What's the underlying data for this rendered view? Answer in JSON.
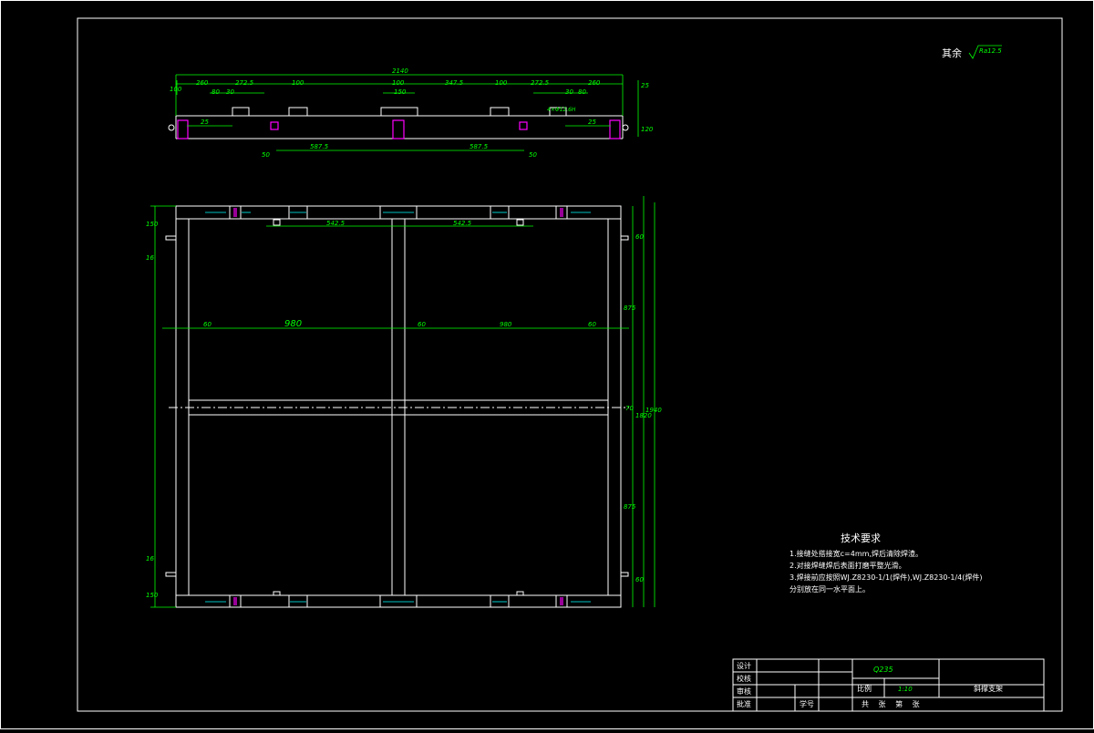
{
  "top_note": {
    "label": "其余",
    "roughness": "Ra12.5"
  },
  "top_view": {
    "dims": {
      "overall": "2140",
      "d260a": "260",
      "d272a": "272.5",
      "d100a": "100",
      "d100b": "100",
      "d347": "347.5",
      "d100c": "100",
      "d272b": "272.5",
      "d260b": "260",
      "d80a": "80",
      "d30a": "30",
      "d150": "150",
      "d30b": "30",
      "d80b": "80",
      "d25a": "25",
      "d25b": "25",
      "d587a": "587.5",
      "d587b": "587.5",
      "d50a": "50",
      "d50b": "50",
      "r25": "25",
      "r120": "120",
      "hole": "4×Φ12.6H",
      "left_v": "100"
    }
  },
  "front_view": {
    "dims": {
      "d150a": "150",
      "d16a": "16",
      "d16b": "16",
      "d150b": "150",
      "d542a": "542.5",
      "d542b": "542.5",
      "d60a": "60",
      "d980a": "980",
      "d60b": "60",
      "d980b": "980",
      "d60c": "60",
      "r60a": "60",
      "r875a": "875",
      "r70": "70",
      "r1820": "1820",
      "r1940": "1940",
      "r875b": "875",
      "r60b": "60"
    }
  },
  "tech_req": {
    "title": "技术要求",
    "items": [
      "1.接缝处搭接宽c=4mm,焊后清除焊渣。",
      "2.对接焊缝焊后表面打磨平整光滑。",
      "3.焊接前应按照WJ.Z8230-1/1(焊件),WJ.Z8230-1/4(焊件)",
      "  分别放在同一水平面上。"
    ]
  },
  "title_block": {
    "material": "Q235",
    "scale_label": "比例",
    "scale_value": "1:10",
    "part_name": "斜撑支架",
    "rows": [
      "设计",
      "校核",
      "审核",
      "批准"
    ],
    "student_no": "学号",
    "sheets": "共 张 第 张"
  }
}
